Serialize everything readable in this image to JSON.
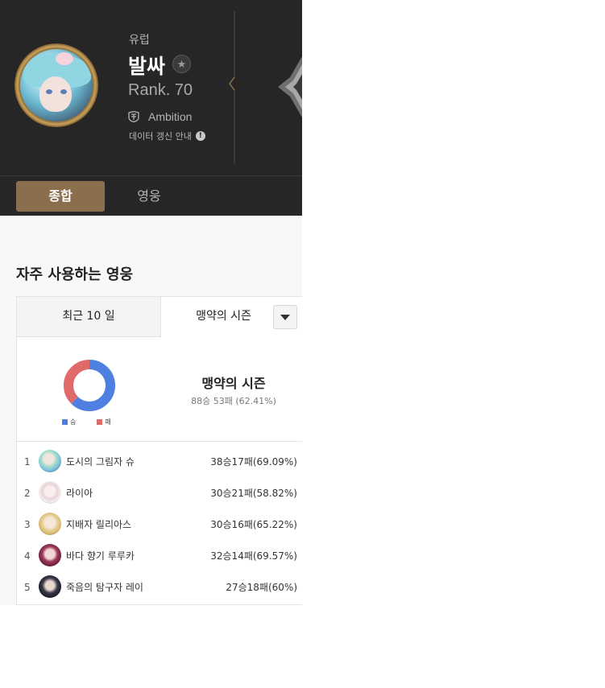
{
  "profile": {
    "region": "유럽",
    "name": "발싸",
    "favorite_icon": "star-icon",
    "rank": "Rank. 70",
    "guild": {
      "icon": "guild-emblem-icon",
      "name": "Ambition"
    },
    "notice": {
      "label": "데이터 갱신 안내",
      "icon": "exclamation-icon",
      "icon_glyph": "!"
    }
  },
  "tabs": [
    {
      "label": "종합",
      "active": true
    },
    {
      "label": "영웅",
      "active": false
    }
  ],
  "frequent_heroes": {
    "title": "자주 사용하는 영웅",
    "period_tabs": [
      {
        "label": "최근 10 일",
        "active": false
      },
      {
        "label": "맹약의 시즌",
        "active": true
      }
    ],
    "dropdown_icon": "chevron-down-icon",
    "summary": {
      "season_title": "맹약의 시즌",
      "record": "88승 53패 (62.41%)",
      "chart_legend": [
        {
          "label": "승",
          "color": "#4f7fe0"
        },
        {
          "label": "패",
          "color": "#e06a6a"
        }
      ],
      "wins": 88,
      "losses": 53
    },
    "heroes": [
      {
        "rank": "1",
        "name": "도시의 그림자 슈",
        "record": "38승17패(69.09%)"
      },
      {
        "rank": "2",
        "name": "라이아",
        "record": "30승21패(58.82%)"
      },
      {
        "rank": "3",
        "name": "지배자 릴리아스",
        "record": "30승16패(65.22%)"
      },
      {
        "rank": "4",
        "name": "바다 향기 루루카",
        "record": "32승14패(69.57%)"
      },
      {
        "rank": "5",
        "name": "죽음의 탐구자 레이",
        "record": "27승18패(60%)"
      }
    ]
  }
}
